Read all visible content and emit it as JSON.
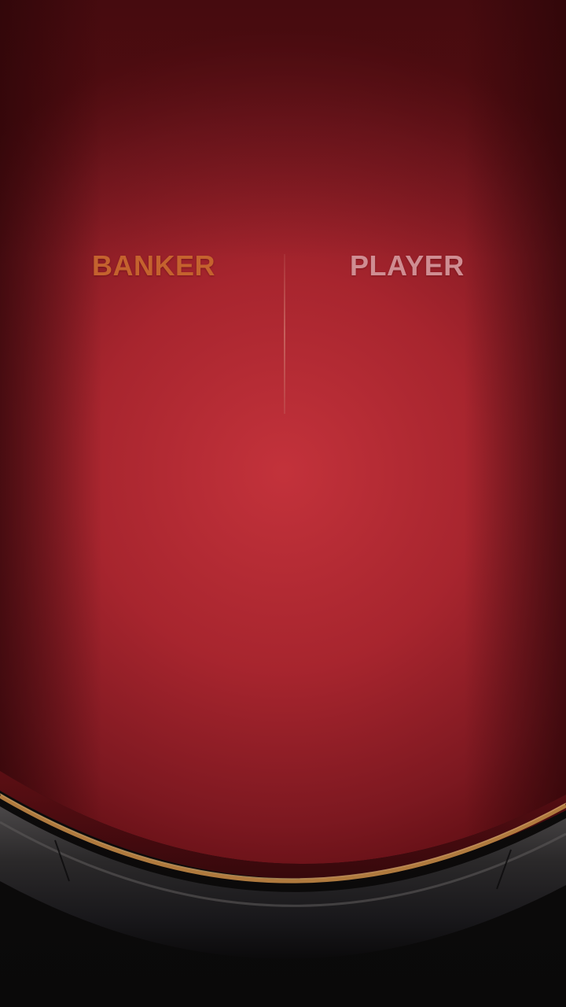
{
  "table": {
    "banker_label": "BANKER",
    "player_label": "PLAYER"
  },
  "colors": {
    "banker": "#c4622e",
    "player": "#cf8d92",
    "felt_center": "#c3323b",
    "felt_edge": "#5c0d12",
    "rail": "#1e1c1d",
    "trim": "#b07a3e",
    "floor": "#0e0c0c"
  }
}
